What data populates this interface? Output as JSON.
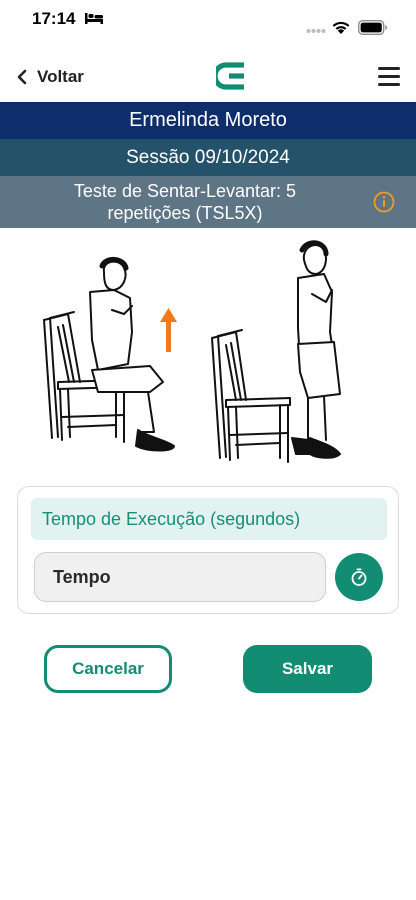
{
  "status_bar": {
    "time": "17:14",
    "icons": [
      "bed-icon",
      "signal-dots-icon",
      "wifi-icon",
      "battery-icon"
    ]
  },
  "nav": {
    "back_label": "Voltar",
    "logo": "app-logo-e",
    "menu_icon": "hamburger-menu-icon"
  },
  "patient": {
    "name": "Ermelinda Moreto"
  },
  "session": {
    "label": "Sessão 09/10/2024"
  },
  "test": {
    "title": "Teste de Sentar-Levantar: 5 repetições (TSL5X)",
    "info_icon": "info-icon"
  },
  "illustration": {
    "description_icons": [
      "seated-person-on-chair",
      "up-arrow-icon",
      "standing-person-beside-chair"
    ]
  },
  "form": {
    "field_label": "Tempo de Execução (segundos)",
    "input_value": "",
    "input_placeholder": "Tempo",
    "timer_icon": "stopwatch-icon"
  },
  "actions": {
    "cancel_label": "Cancelar",
    "save_label": "Salvar"
  },
  "colors": {
    "primary_green": "#138c74",
    "name_band": "#0e2d6b",
    "session_band": "#25526b",
    "test_band": "#5e7585",
    "label_bg": "#e2f2ef",
    "info_orange": "#f29b1f",
    "arrow_orange": "#f07a1c"
  }
}
